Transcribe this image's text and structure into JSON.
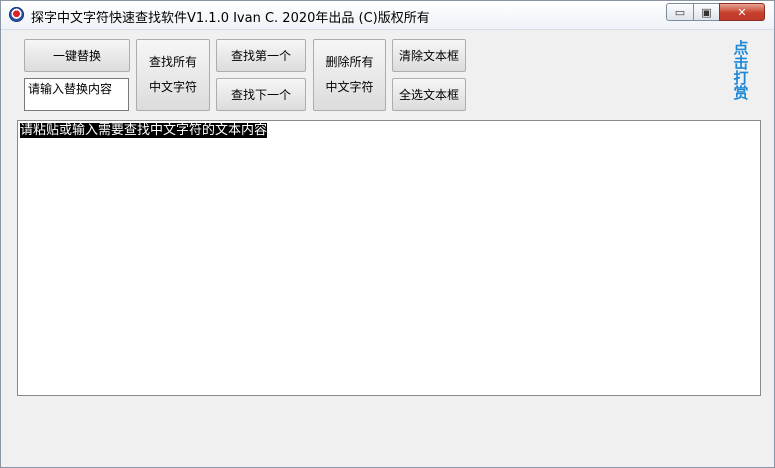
{
  "window": {
    "title": "探字中文字符快速查找软件V1.1.0   Ivan C. 2020年出品 (C)版权所有",
    "controls": {
      "minimize": "▭",
      "maximize": "▣",
      "close": "✕"
    }
  },
  "toolbar": {
    "replace_all": "一键替换",
    "replace_placeholder": "请输入替换内容",
    "find_all_line1": "查找所有",
    "find_all_line2": "中文字符",
    "find_first": "查找第一个",
    "find_next": "查找下一个",
    "delete_all_line1": "删除所有",
    "delete_all_line2": "中文字符",
    "clear_text": "清除文本框",
    "select_all_text": "全选文本框"
  },
  "reward": {
    "chars": [
      "点",
      "击",
      "打",
      "赏"
    ]
  },
  "editor": {
    "text": "请粘贴或输入需要查找中文字符的文本内容"
  }
}
